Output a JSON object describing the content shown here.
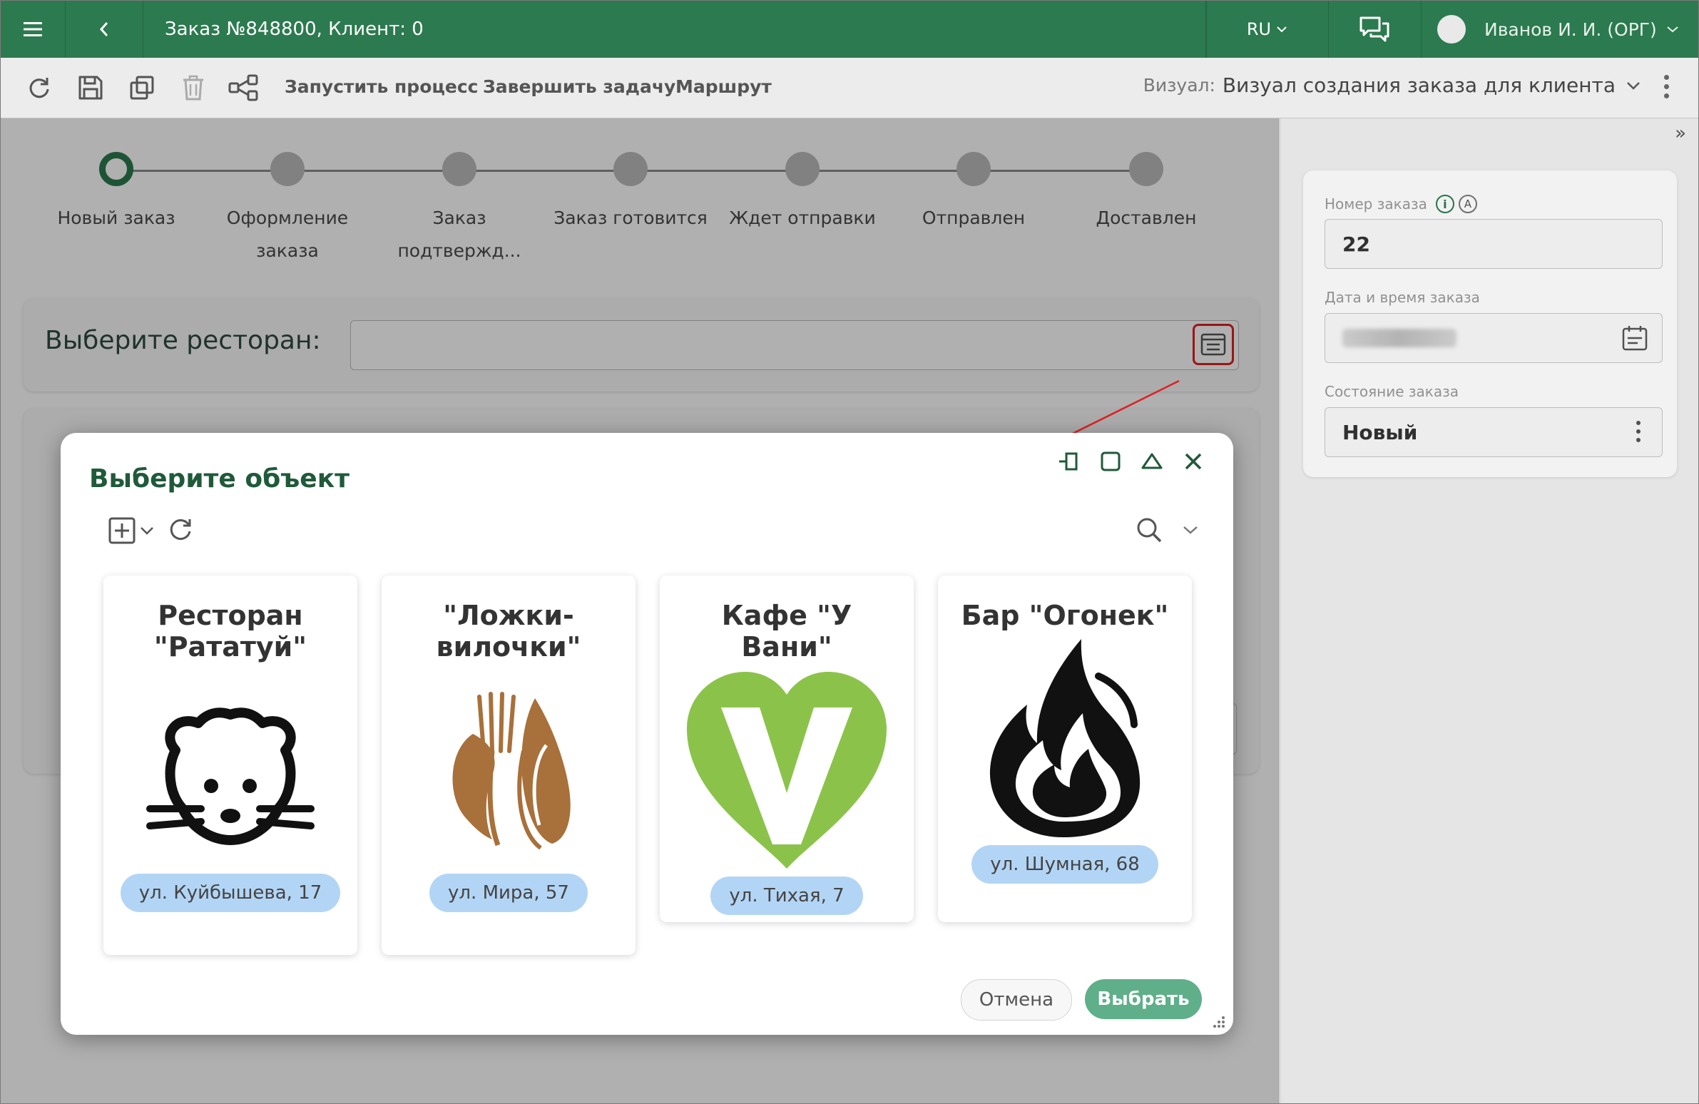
{
  "header": {
    "title": "Заказ №848800, Клиент: 0",
    "language": "RU",
    "user": "Иванов И. И. (ОРГ)"
  },
  "toolbar": {
    "start_process": "Запустить процесс",
    "finish_task": "Завершить задачу",
    "route": "Маршрут",
    "visual_label": "Визуал:",
    "visual_value": "Визуал создания заказа для клиента"
  },
  "stages": [
    {
      "label": "Новый заказ",
      "active": true
    },
    {
      "label": "Оформление заказа",
      "active": false
    },
    {
      "label": "Заказ подтвержд...",
      "active": false
    },
    {
      "label": "Заказ готовится",
      "active": false
    },
    {
      "label": "Ждет отправки",
      "active": false
    },
    {
      "label": "Отправлен",
      "active": false
    },
    {
      "label": "Доставлен",
      "active": false
    }
  ],
  "form": {
    "restaurant_label": "Выберите ресторан:",
    "restaurant_value": ""
  },
  "side": {
    "order_number_label": "Номер заказа",
    "order_number_value": "22",
    "order_datetime_label": "Дата и время заказа",
    "order_state_label": "Состояние заказа",
    "order_state_value": "Новый"
  },
  "dialog": {
    "title": "Выберите объект",
    "cancel": "Отмена",
    "select": "Выбрать",
    "items": [
      {
        "name": "Ресторан \"Рататуй\"",
        "address": "ул. Куйбышева, 17",
        "icon": "rat-icon"
      },
      {
        "name": "\"Ложки-вилочки\"",
        "address": "ул. Мира, 57",
        "icon": "spoon-fork-icon"
      },
      {
        "name": "Кафе \"У Вани\"",
        "address": "ул. Тихая, 7",
        "icon": "green-heart-v-icon"
      },
      {
        "name": "Бар \"Огонек\"",
        "address": "ул. Шумная, 68",
        "icon": "flame-icon"
      }
    ]
  },
  "colors": {
    "brand": "#2c7a4f",
    "chip": "#b3d5f5",
    "annotation": "#e02020",
    "select_button": "#5faf8a",
    "heart": "#8bc34a",
    "spoon": "#a8703a"
  }
}
